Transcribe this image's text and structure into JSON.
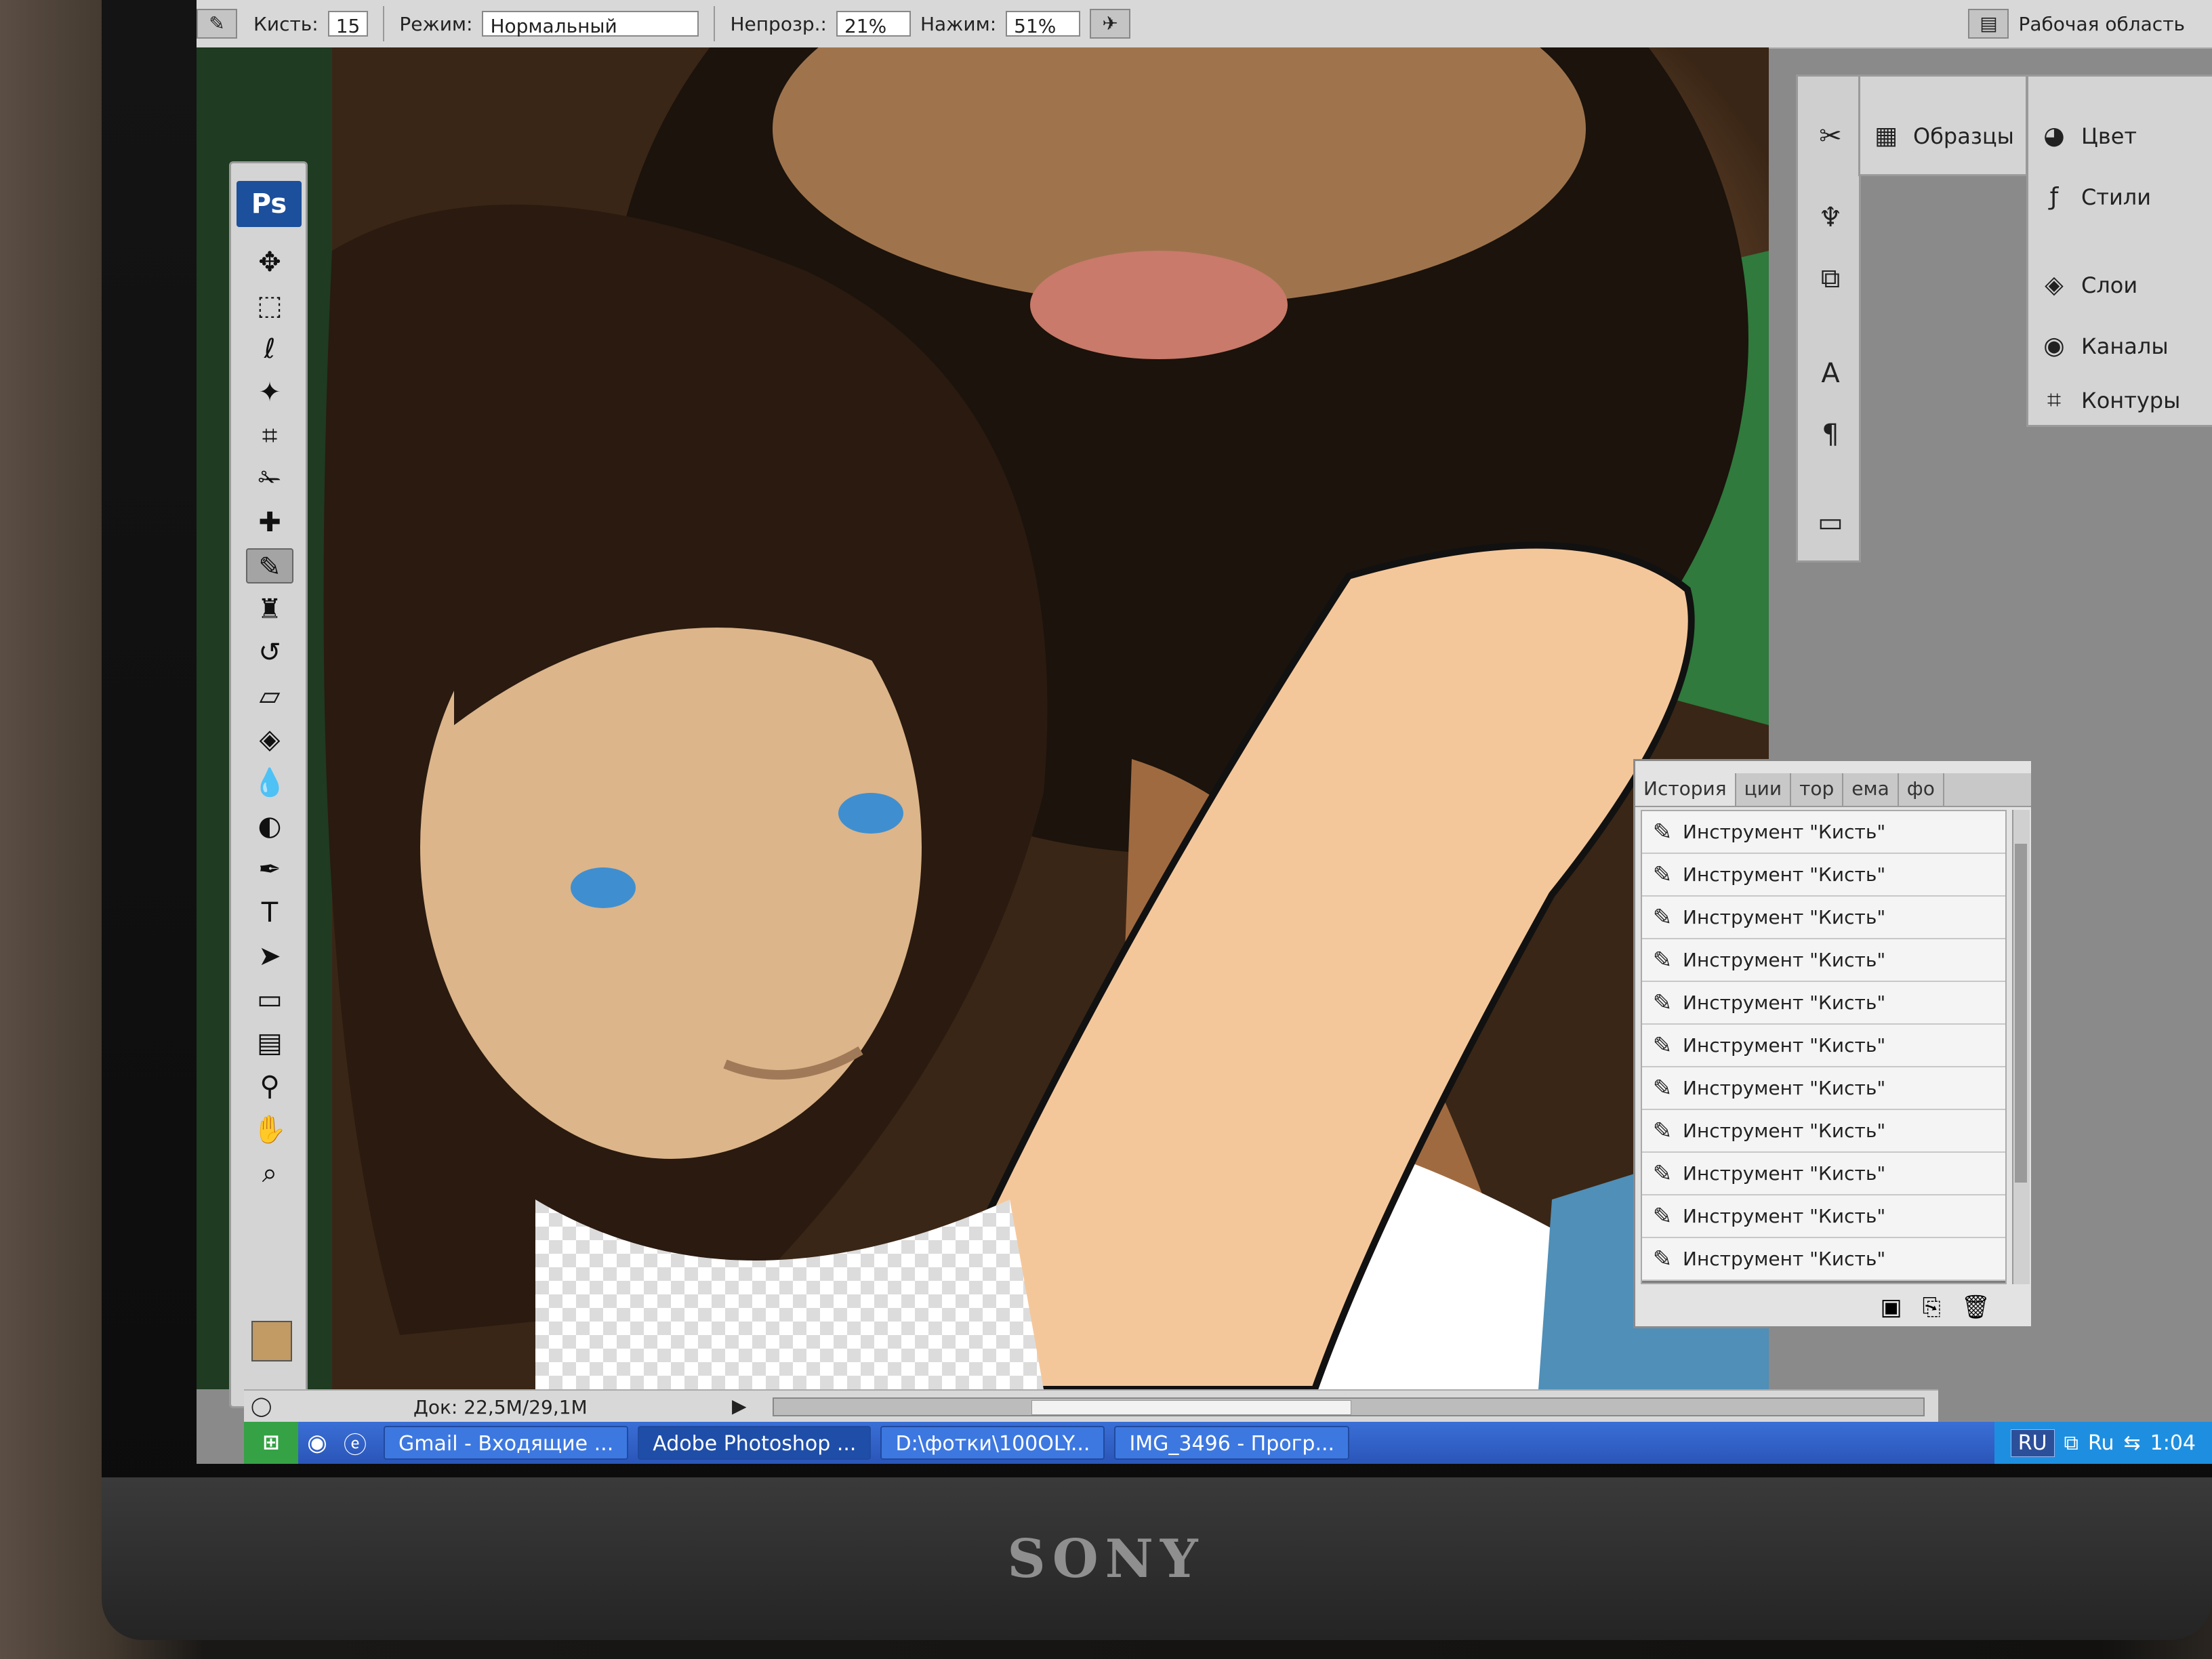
{
  "monitor": {
    "brand": "SONY"
  },
  "options_bar": {
    "brush_label": "Кисть:",
    "brush_size": "15",
    "mode_label": "Режим:",
    "mode_value": "Нормальный",
    "opacity_label": "Непрозр.:",
    "opacity_value": "21%",
    "flow_label": "Нажим:",
    "flow_value": "51%",
    "workspace_label": "Рабочая область"
  },
  "tools": {
    "logo": "Ps",
    "foreground_color": "#c29a64",
    "items": [
      {
        "icon": "move-icon"
      },
      {
        "icon": "marquee-icon"
      },
      {
        "icon": "lasso-icon"
      },
      {
        "icon": "magic-wand-icon"
      },
      {
        "icon": "crop-icon"
      },
      {
        "icon": "slice-icon"
      },
      {
        "icon": "healing-brush-icon"
      },
      {
        "icon": "brush-icon",
        "active": true
      },
      {
        "icon": "stamp-icon"
      },
      {
        "icon": "history-brush-icon"
      },
      {
        "icon": "eraser-icon"
      },
      {
        "icon": "paint-bucket-icon"
      },
      {
        "icon": "blur-icon"
      },
      {
        "icon": "dodge-icon"
      },
      {
        "icon": "pen-icon"
      },
      {
        "icon": "type-icon"
      },
      {
        "icon": "path-selection-icon"
      },
      {
        "icon": "shape-icon"
      },
      {
        "icon": "notes-icon"
      },
      {
        "icon": "eyedropper-icon"
      },
      {
        "icon": "hand-icon"
      },
      {
        "icon": "zoom-icon"
      }
    ]
  },
  "status_bar": {
    "doc_size": "Док: 22,5M/29,1M"
  },
  "panels": {
    "swatches": "Образцы",
    "color": "Цвет",
    "styles": "Стили",
    "layers": "Слои",
    "channels": "Каналы",
    "paths": "Контуры"
  },
  "history": {
    "tabs": [
      "История",
      "ции",
      "тор",
      "ема",
      "фо"
    ],
    "items": [
      "Инструмент \"Кисть\"",
      "Инструмент \"Кисть\"",
      "Инструмент \"Кисть\"",
      "Инструмент \"Кисть\"",
      "Инструмент \"Кисть\"",
      "Инструмент \"Кисть\"",
      "Инструмент \"Кисть\"",
      "Инструмент \"Кисть\"",
      "Инструмент \"Кисть\"",
      "Инструмент \"Кисть\"",
      "Инструмент \"Кисть\"",
      "Инструмент \"Кисть\""
    ],
    "selected_index": 11
  },
  "taskbar": {
    "tasks": [
      "Gmail - Входящие ...",
      "Adobe Photoshop ...",
      "D:\\фотки\\100OLY...",
      "IMG_3496 - Прогр..."
    ],
    "active_task": 1,
    "language": "RU",
    "tray_lang": "Ru",
    "clock": "1:04"
  }
}
